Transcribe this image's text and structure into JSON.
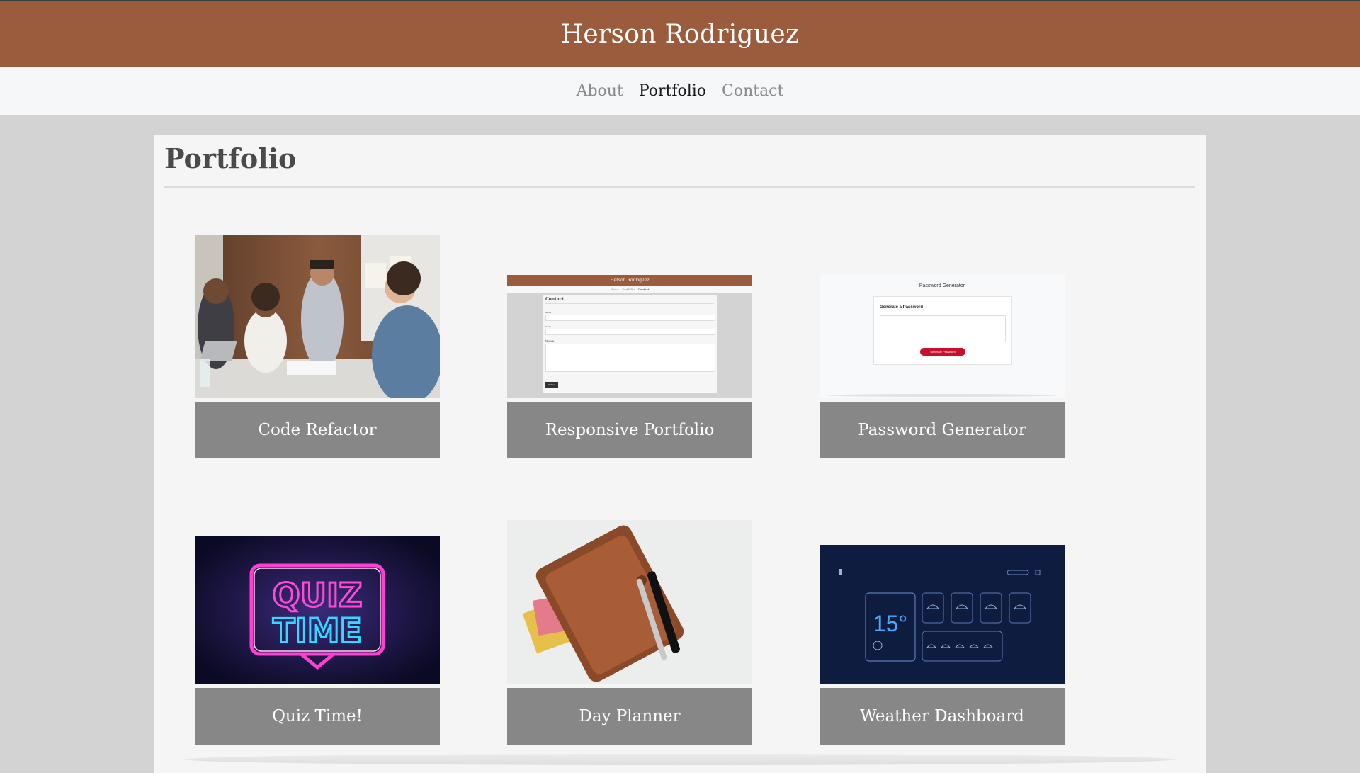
{
  "site": {
    "title": "Herson Rodriguez"
  },
  "nav": [
    {
      "label": "About",
      "active": false
    },
    {
      "label": "Portfolio",
      "active": true
    },
    {
      "label": "Contact",
      "active": false
    }
  ],
  "page": {
    "title": "Portfolio"
  },
  "projects": [
    {
      "title": "Code Refactor",
      "image": "team-meeting-photo"
    },
    {
      "title": "Responsive Portfolio",
      "image": "contact-page-screenshot",
      "preview": {
        "header": "Herson Rodriguez",
        "nav": [
          "About",
          "Portfolio",
          "Contact"
        ],
        "heading": "Contact",
        "name_label": "Name",
        "email_label": "Email",
        "message_label": "Message",
        "button": "Submit"
      }
    },
    {
      "title": "Password Generator",
      "image": "password-generator-screenshot",
      "preview": {
        "title": "Password Generator",
        "card_title": "Generate a Password",
        "button": "Generate Password"
      }
    },
    {
      "title": "Quiz Time!",
      "image": "neon-quiz-sign",
      "neon": [
        "QUIZ",
        "TIME"
      ]
    },
    {
      "title": "Day Planner",
      "image": "leather-planner-photo"
    },
    {
      "title": "Weather Dashboard",
      "image": "weather-dashboard-screenshot",
      "preview": {
        "temperature": "15°"
      }
    }
  ],
  "colors": {
    "header": "#9a5c3c",
    "nav_bg": "#f6f7f9",
    "page_bg": "#d3d3d3",
    "panel_bg": "#f5f5f5",
    "label_bg": "#878787"
  }
}
